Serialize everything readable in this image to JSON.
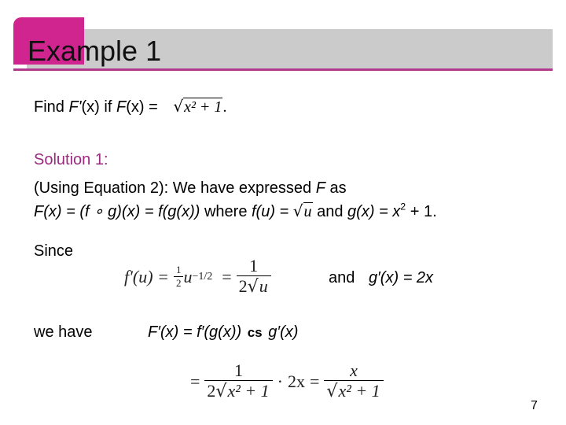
{
  "slide": {
    "title": "Example 1",
    "page_number": "7",
    "colors": {
      "accent": "#d0248f",
      "title_bar": "#cbcbcb",
      "rule": "#b23a8c",
      "solution_label": "#9b2a7f"
    }
  },
  "problem": {
    "find": "Find ",
    "Fprime": "F'",
    "x_paren": "(x)",
    "if": " if ",
    "F": "F",
    "eq": "(x) = ",
    "radicand": "x² + 1",
    "period": "."
  },
  "solution": {
    "label": "Solution 1:",
    "line1_a": "(Using Equation 2): We have expressed ",
    "line1_F": "F",
    "line1_b": " as",
    "line2_a": "F(x) = (f ∘ g)(x) = f(g(x))",
    "line2_where": " where ",
    "line2_fu": "f(u) = ",
    "line2_radicand": "u",
    "line2_and": " and ",
    "line2_gx": "g(x) = x",
    "line2_exp": "2",
    "line2_tail": " + 1.",
    "since": "Since",
    "fprime_lhs": "f′(u) =",
    "half_num": "1",
    "half_den": "2",
    "u": "u",
    "u_exp": "−1/2",
    "eq": "=",
    "frac_num": "1",
    "frac_den_coef": "2",
    "frac_den_rad": "u",
    "and_label": "and",
    "gprime": "g′(x) = 2x",
    "we_have": "we have",
    "chain_lhs": "F′(x) = f′(g(x))",
    "chain_op": "cs",
    "chain_rhs": "g′(x)",
    "final_eq1": "=",
    "final_num1": "1",
    "final_den1_coef": "2",
    "final_den1_rad": "x² + 1",
    "dot": "·",
    "two_x": "2x",
    "final_eq2": "=",
    "final_num2": "x",
    "final_den2_rad": "x² + 1"
  }
}
